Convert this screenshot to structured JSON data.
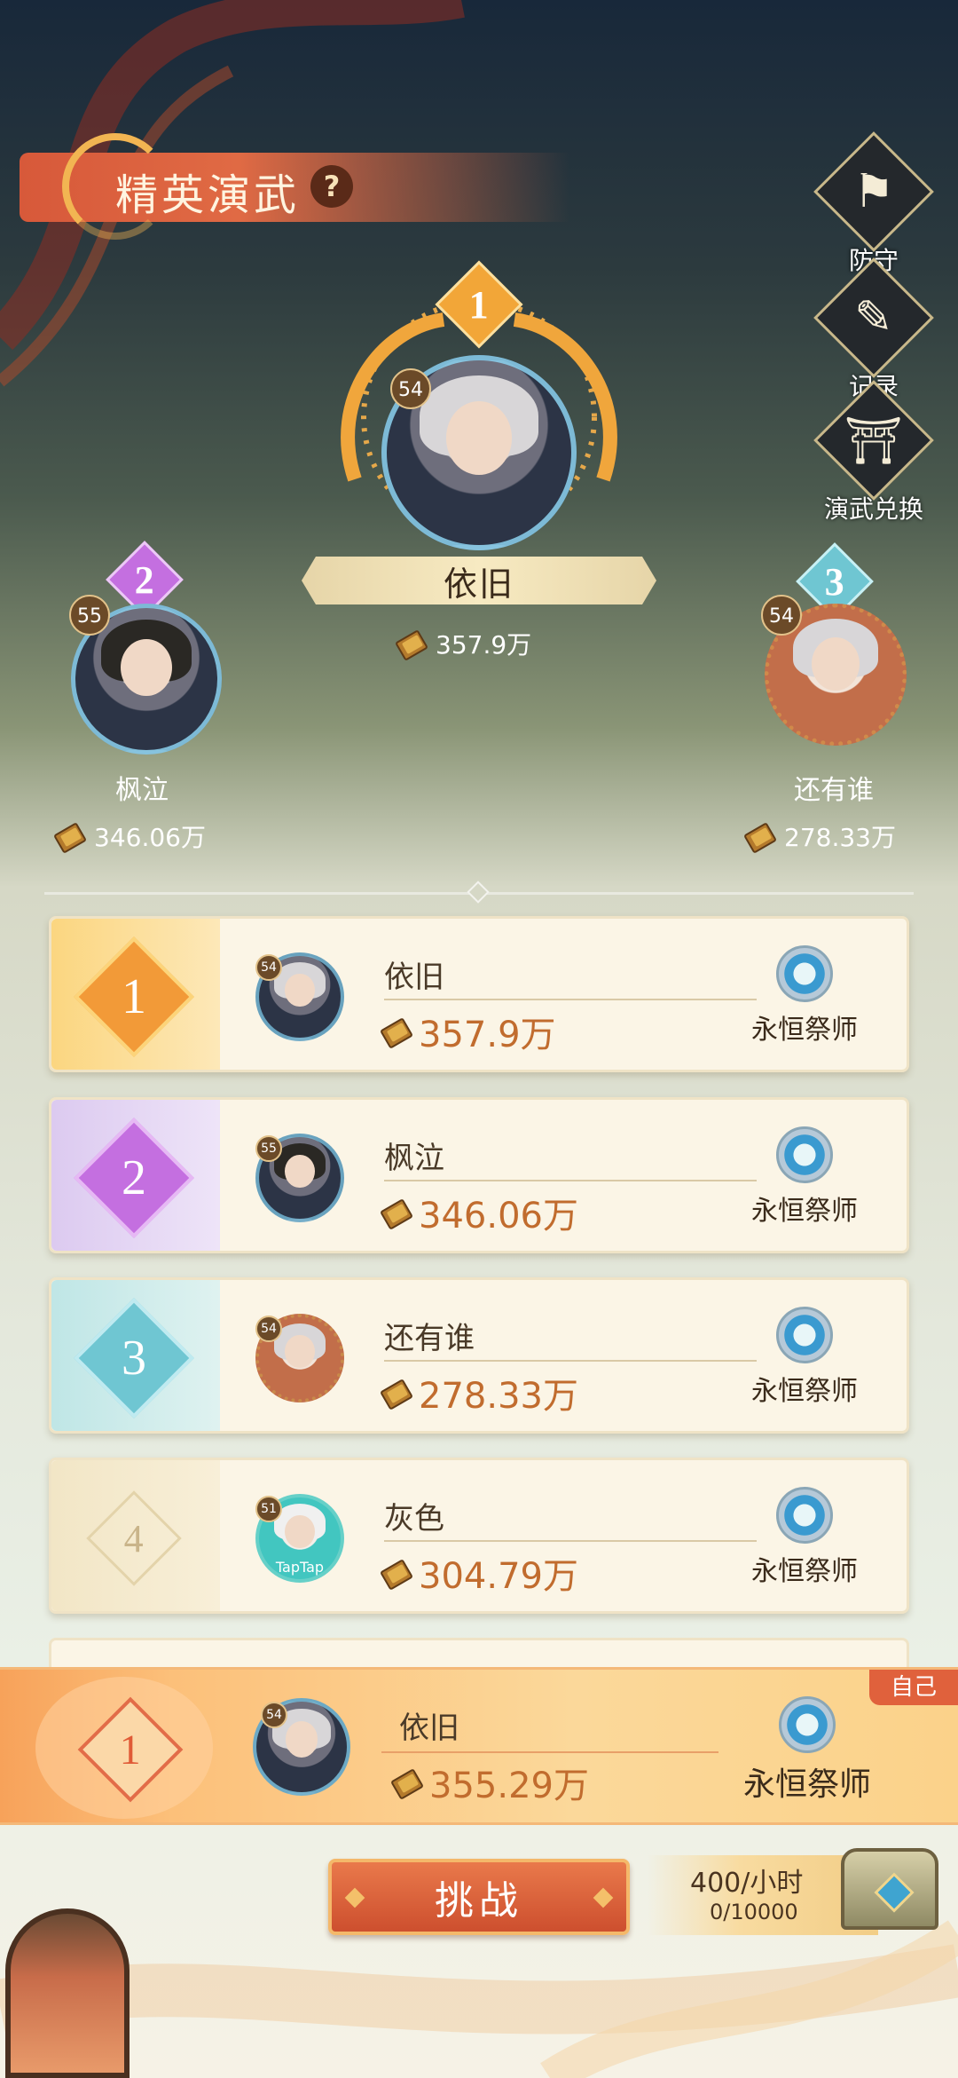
{
  "header": {
    "title": "精英演武",
    "help": "?"
  },
  "side_buttons": [
    {
      "label": "防守",
      "icon": "flag-icon"
    },
    {
      "label": "记录",
      "icon": "scroll-icon"
    },
    {
      "label": "演武兑换",
      "icon": "pavilion-icon"
    }
  ],
  "podium": {
    "first": {
      "rank": "1",
      "level": "54",
      "name": "依旧",
      "score": "357.9万"
    },
    "second": {
      "rank": "2",
      "level": "55",
      "name": "枫泣",
      "score": "346.06万"
    },
    "third": {
      "rank": "3",
      "level": "54",
      "name": "还有谁",
      "score": "278.33万"
    }
  },
  "rankings": [
    {
      "rank": "1",
      "level": "54",
      "name": "依旧",
      "score": "357.9万",
      "title": "永恒祭师"
    },
    {
      "rank": "2",
      "level": "55",
      "name": "枫泣",
      "score": "346.06万",
      "title": "永恒祭师"
    },
    {
      "rank": "3",
      "level": "54",
      "name": "还有谁",
      "score": "278.33万",
      "title": "永恒祭师"
    },
    {
      "rank": "4",
      "level": "51",
      "name": "灰色",
      "score": "304.79万",
      "title": "永恒祭师",
      "avatar_caption": "TapTap"
    }
  ],
  "self": {
    "tag": "自己",
    "rank": "1",
    "level": "54",
    "name": "依旧",
    "score": "355.29万",
    "title": "永恒祭师"
  },
  "bottom": {
    "challenge_label": "挑战",
    "reward_rate": "400/小时",
    "reward_cap": "0/10000"
  },
  "colors": {
    "accent_orange": "#e0613c",
    "rank1": "#f2a638",
    "rank2": "#c46fe0",
    "rank3": "#6fc6d2",
    "score_text": "#c16c2e"
  }
}
